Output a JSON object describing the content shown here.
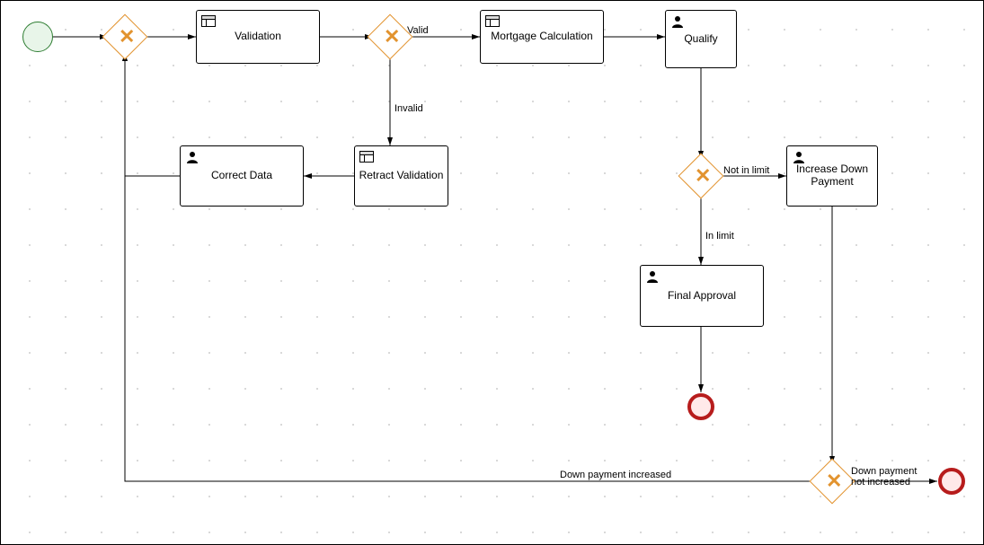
{
  "tasks": {
    "validation": {
      "label": "Validation"
    },
    "mortgage": {
      "label": "Mortgage Calculation"
    },
    "qualify": {
      "label": "Qualify"
    },
    "retract": {
      "label": "Retract Validation"
    },
    "correct": {
      "label": "Correct Data"
    },
    "final": {
      "label": "Final Approval"
    },
    "increase": {
      "label": "Increase Down Payment"
    }
  },
  "edgeLabels": {
    "valid": "Valid",
    "invalid": "Invalid",
    "notInLimit": "Not in limit",
    "inLimit": "In limit",
    "dpIncreased": "Down payment increased",
    "dpNotIncreased": "Down payment not increased"
  }
}
